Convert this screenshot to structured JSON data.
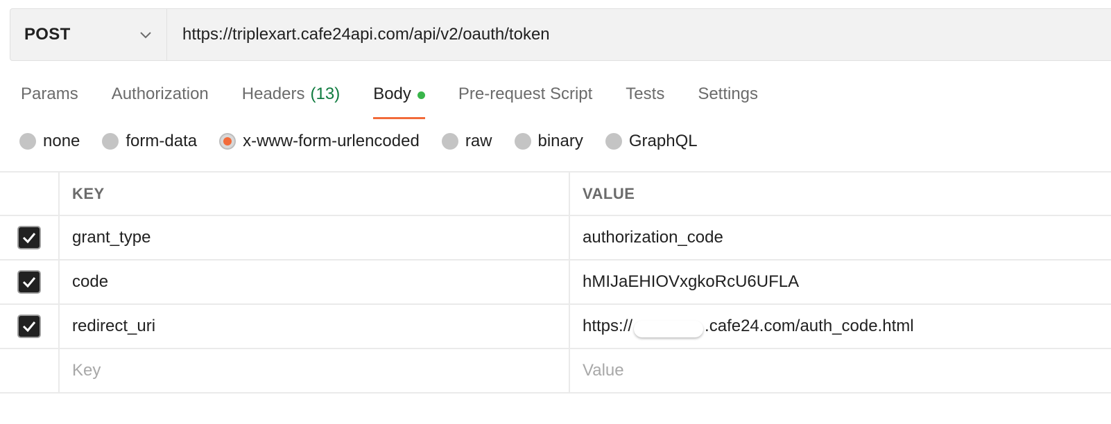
{
  "request": {
    "method": "POST",
    "url": "https://triplexart.cafe24api.com/api/v2/oauth/token"
  },
  "tabs": [
    {
      "label": "Params"
    },
    {
      "label": "Authorization"
    },
    {
      "label": "Headers",
      "count": "(13)"
    },
    {
      "label": "Body",
      "active": true
    },
    {
      "label": "Pre-request Script"
    },
    {
      "label": "Tests"
    },
    {
      "label": "Settings"
    }
  ],
  "body_types": [
    {
      "label": "none",
      "selected": false
    },
    {
      "label": "form-data",
      "selected": false
    },
    {
      "label": "x-www-form-urlencoded",
      "selected": true
    },
    {
      "label": "raw",
      "selected": false
    },
    {
      "label": "binary",
      "selected": false
    },
    {
      "label": "GraphQL",
      "selected": false
    }
  ],
  "table": {
    "headers": {
      "key": "KEY",
      "value": "VALUE"
    },
    "rows": [
      {
        "checked": true,
        "key": "grant_type",
        "value": "authorization_code"
      },
      {
        "checked": true,
        "key": "code",
        "value": "hMIJaEHIOVxgkoRcU6UFLA"
      },
      {
        "checked": true,
        "key": "redirect_uri",
        "value_prefix": "https://",
        "value_suffix": ".cafe24.com/auth_code.html"
      }
    ],
    "placeholder": {
      "key": "Key",
      "value": "Value"
    }
  },
  "colors": {
    "accent": "#f26b3a",
    "success": "#39b54a",
    "count_text": "#0f7b3f"
  }
}
